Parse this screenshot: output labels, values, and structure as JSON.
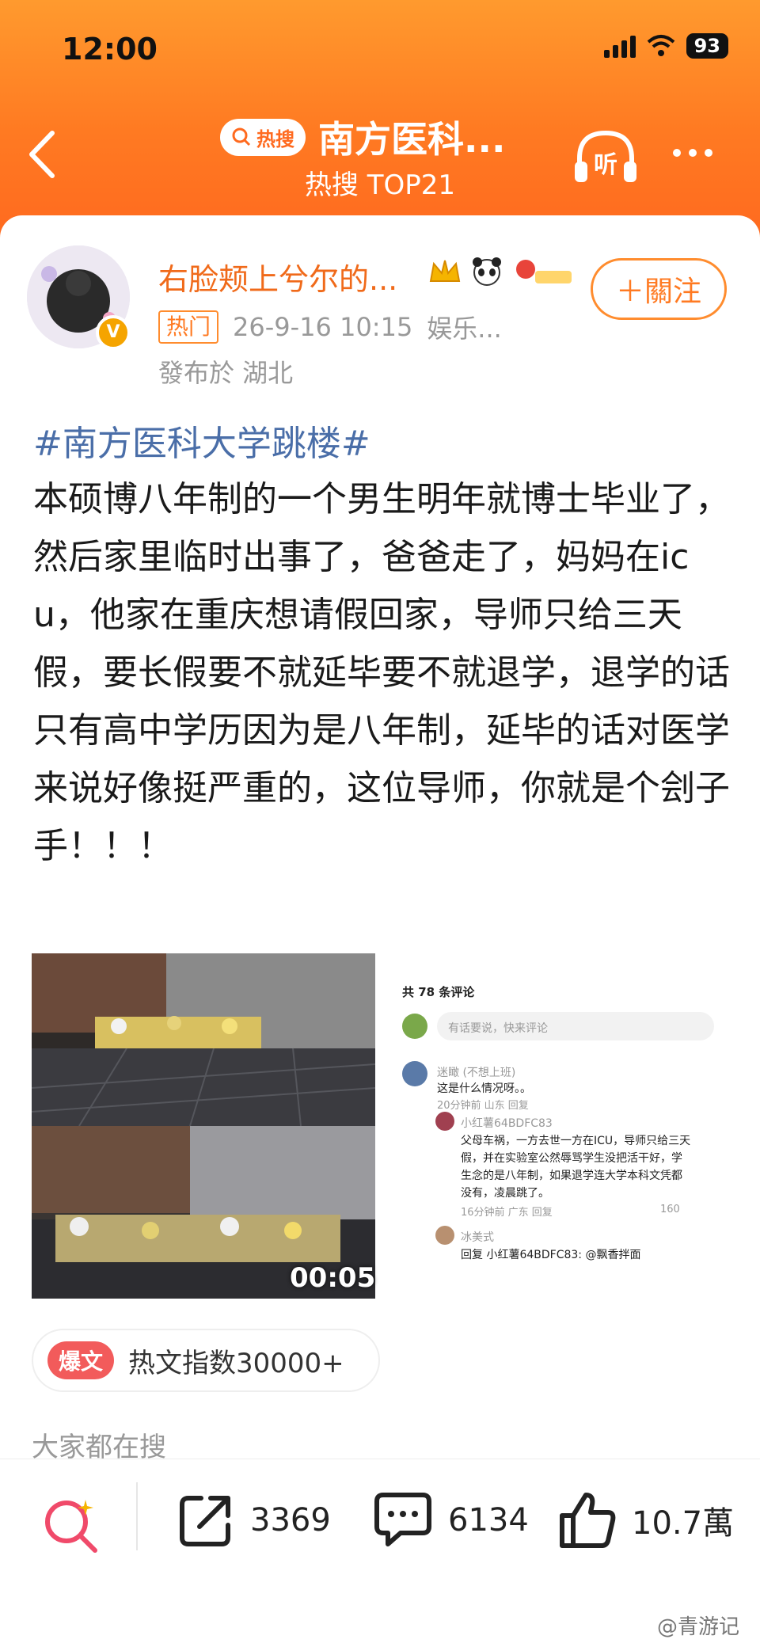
{
  "status_bar": {
    "time": "12:00",
    "battery": "93"
  },
  "nav": {
    "hot_badge": "热搜",
    "title": "南方医科...",
    "subtitle": "热搜 TOP21",
    "listen_label": "听"
  },
  "post": {
    "username": "右脸颊上兮尔的...",
    "vip_mark": "V",
    "follow_label": "＋關注",
    "hot_tag": "热门",
    "timestamp": "26-9-16 10:15",
    "category": "娱乐...",
    "location": "發布於 湖北",
    "hashtag": "#南方医科大学跳楼#",
    "body": "本硕博八年制的一个男生明年就博士毕业了，然后家里临时出事了，爸爸走了，妈妈在icu，他家在重庆想请假回家，导师只给三天假，要长假要不就延毕要不就退学，退学的话只有高中学历因为是八年制，延毕的话对医学来说好像挺严重的，这位导师，你就是个刽子手！！！",
    "video_duration": "00:05"
  },
  "screenshot_comments": {
    "count": "共 78 条评论",
    "input_placeholder": "有话要说，快来评论",
    "comments": [
      {
        "user": "迷瞰 (不想上班)",
        "text": "这是什么情况呀。。",
        "meta": "20分钟前 山东  回复"
      },
      {
        "user": "小红薯64BDFC83",
        "text_lines": [
          "父母车祸，一方去世一方在ICU，导师只给三天",
          "假，并在实验室公然辱骂学生没把活干好，学",
          "生念的是八年制，如果退学连大学本科文凭都",
          "没有，凌晨跳了。"
        ],
        "meta": "16分钟前 广东  回复",
        "likes": "160"
      },
      {
        "user": "冰美式",
        "text": "回复 小红薯64BDFC83: @飘香拌面"
      }
    ]
  },
  "hot_index": {
    "tag": "爆文",
    "text": "热文指数30000+"
  },
  "everyone_searching": "大家都在搜",
  "bottom_bar": {
    "shares": "3369",
    "comments": "6134",
    "likes": "10.7萬"
  },
  "watermark": "@青游记",
  "colors": {
    "header_orange": "#ff7a22",
    "hashtag_blue": "#4a6ea8",
    "username_orange": "#f06a1a",
    "explode_red": "#f25b5b"
  }
}
